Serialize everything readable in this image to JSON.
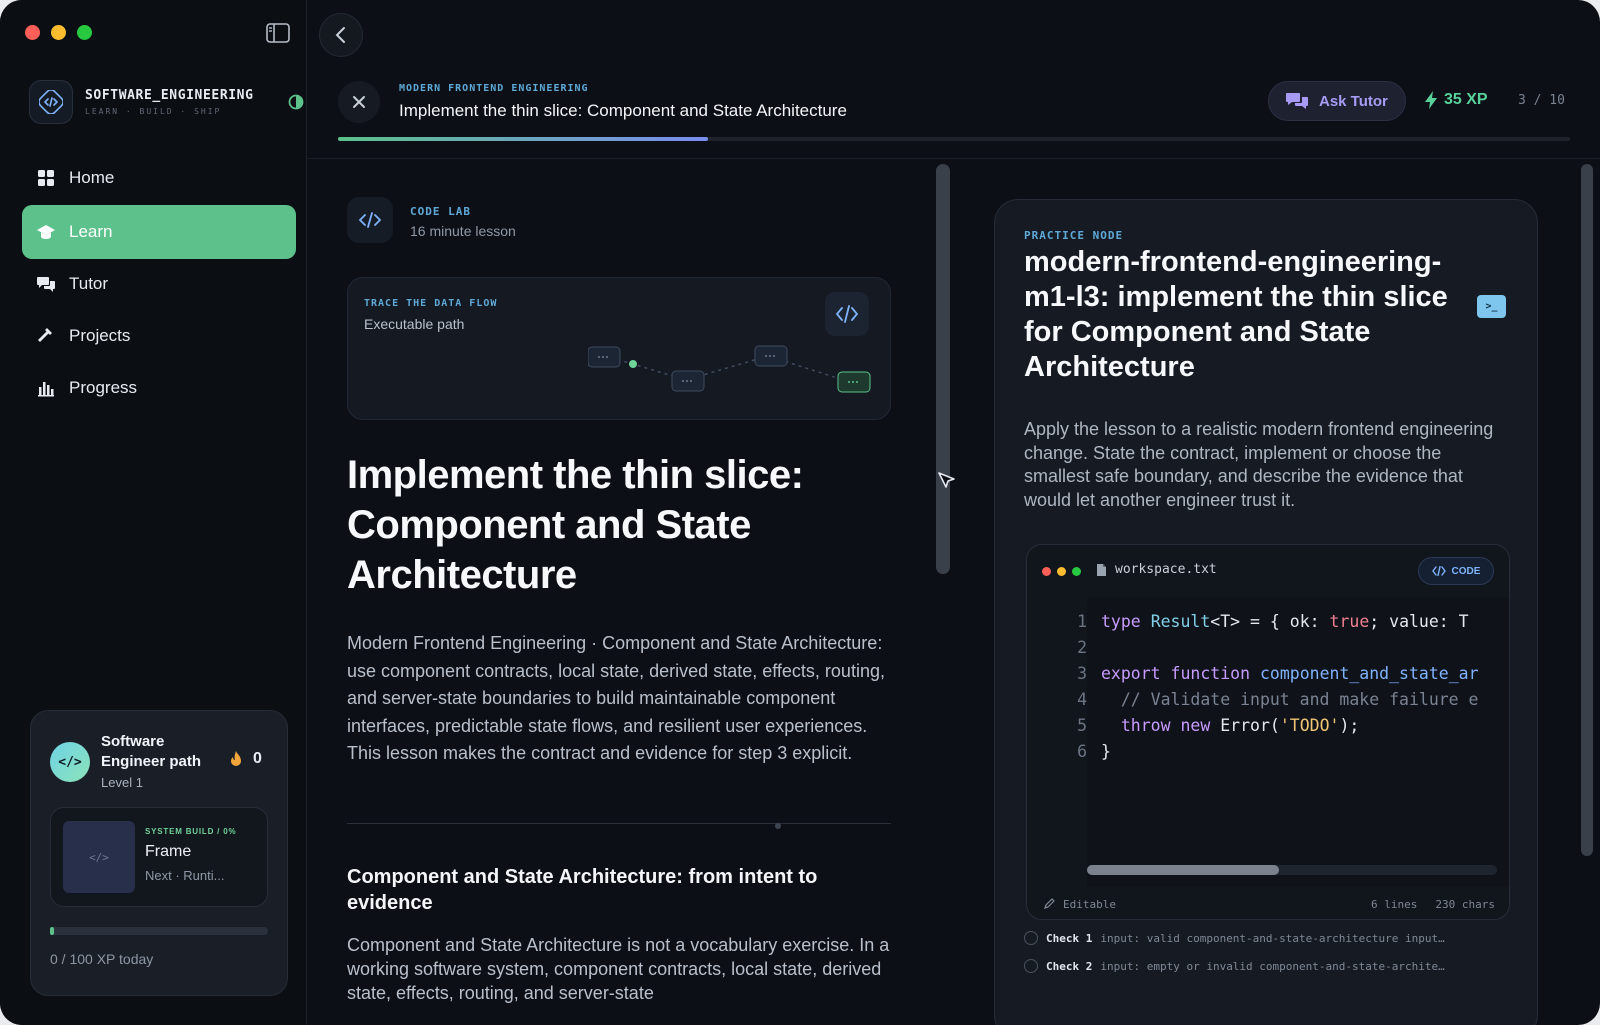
{
  "sidebar": {
    "brand_title": "SOFTWARE_ENGINEERING",
    "brand_subtitle": "LEARN · BUILD · SHIP",
    "nav": [
      {
        "label": "Home",
        "icon": "grid-icon"
      },
      {
        "label": "Learn",
        "icon": "graduation-cap-icon",
        "active": true
      },
      {
        "label": "Tutor",
        "icon": "chat-bubbles-icon"
      },
      {
        "label": "Projects",
        "icon": "hammer-icon"
      },
      {
        "label": "Progress",
        "icon": "bar-chart-icon"
      }
    ],
    "path_card": {
      "title": "Software Engineer path",
      "level": "Level 1",
      "streak": "0",
      "frame_eyebrow": "SYSTEM BUILD / 0%",
      "frame_name": "Frame",
      "frame_next": "Next · Runti...",
      "xp_today": "0 / 100 XP today",
      "xp_today_fraction": 0.02
    }
  },
  "header": {
    "course_eyebrow": "MODERN FRONTEND ENGINEERING",
    "lesson_title": "Implement the thin slice: Component and State Architecture",
    "ask_tutor": "Ask Tutor",
    "xp": "35 XP",
    "step": "3 / 10",
    "progress_fraction": 0.3
  },
  "lesson": {
    "codelab_eyebrow": "CODE LAB",
    "codelab_sub": "16 minute lesson",
    "trace_eyebrow": "TRACE THE DATA FLOW",
    "trace_sub": "Executable path",
    "heading": "Implement the thin slice: Component and State Architecture",
    "body": "Modern Frontend Engineering · Component and State Architecture: use component contracts, local state, derived state, effects, routing, and server-state boundaries to build maintainable component interfaces, predictable state flows, and resilient user experiences. This lesson makes the contract and evidence for step 3 explicit.",
    "subheading": "Component and State Architecture: from intent to evidence",
    "body2": "Component and State Architecture is not a vocabulary exercise. In a working software system, component contracts, local state, derived state, effects, routing, and server-state"
  },
  "practice": {
    "eyebrow": "PRACTICE NODE",
    "title": "modern-frontend-engineering-m1-l3: implement the thin slice for Component and State Architecture",
    "description": "Apply the lesson to a realistic modern frontend engineering change. State the contract, implement or choose the smallest safe boundary, and describe the evidence that would let another engineer trust it.",
    "editor": {
      "filename": "workspace.txt",
      "tag": "CODE",
      "status": "Editable",
      "lines_count": "6 lines",
      "chars_count": "230 chars",
      "line_numbers": [
        "1",
        "2",
        "3",
        "4",
        "5",
        "6"
      ]
    },
    "checks": [
      {
        "label": "Check 1",
        "text": "input: valid component-and-state-architecture input…"
      },
      {
        "label": "Check 2",
        "text": "input: empty or invalid component-and-state-archite…"
      }
    ]
  },
  "colors": {
    "accent_green": "#5cc18a",
    "accent_blue": "#5fa9d8",
    "accent_purple": "#a79bf5"
  }
}
